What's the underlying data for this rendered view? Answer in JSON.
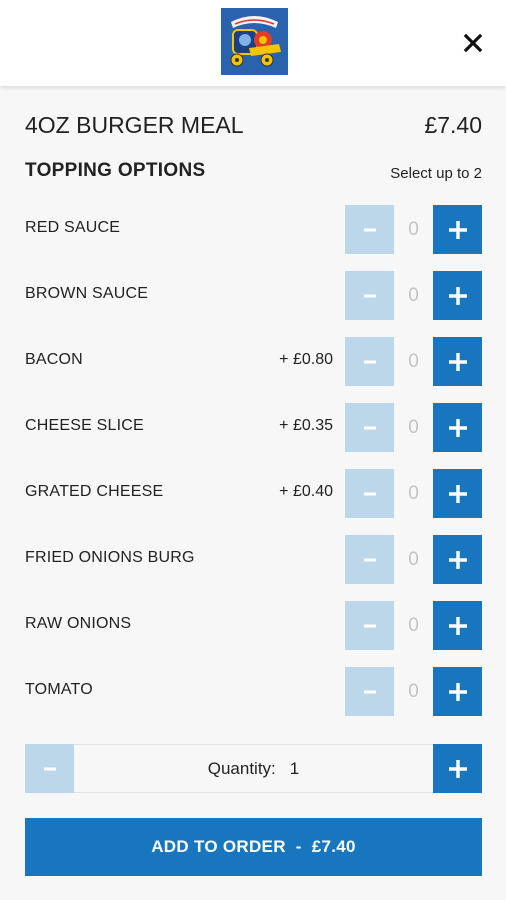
{
  "header": {
    "logo_icon": "restaurant-logo",
    "close_icon": "close-icon"
  },
  "product": {
    "title": "4OZ BURGER MEAL",
    "price": "£7.40"
  },
  "toppings": {
    "title": "TOPPING OPTIONS",
    "hint": "Select up to 2",
    "minus_label": "-",
    "plus_label": "+",
    "items": [
      {
        "label": "RED SAUCE",
        "extra": "",
        "count": "0"
      },
      {
        "label": "BROWN SAUCE",
        "extra": "",
        "count": "0"
      },
      {
        "label": "BACON",
        "extra": "+ £0.80",
        "count": "0"
      },
      {
        "label": "CHEESE SLICE",
        "extra": "+ £0.35",
        "count": "0"
      },
      {
        "label": "GRATED CHEESE",
        "extra": "+ £0.40",
        "count": "0"
      },
      {
        "label": "FRIED ONIONS BURG",
        "extra": "",
        "count": "0"
      },
      {
        "label": "RAW ONIONS",
        "extra": "",
        "count": "0"
      },
      {
        "label": "TOMATO",
        "extra": "",
        "count": "0"
      }
    ]
  },
  "quantity": {
    "label": "Quantity:",
    "value": "1",
    "minus_label": "-",
    "plus_label": "+"
  },
  "add_button": {
    "label": "ADD TO ORDER",
    "separator": "-",
    "price": "£7.40"
  },
  "colors": {
    "accent": "#1776bd",
    "accent_disabled": "#bcd6ea",
    "background": "#f7f7f7"
  }
}
